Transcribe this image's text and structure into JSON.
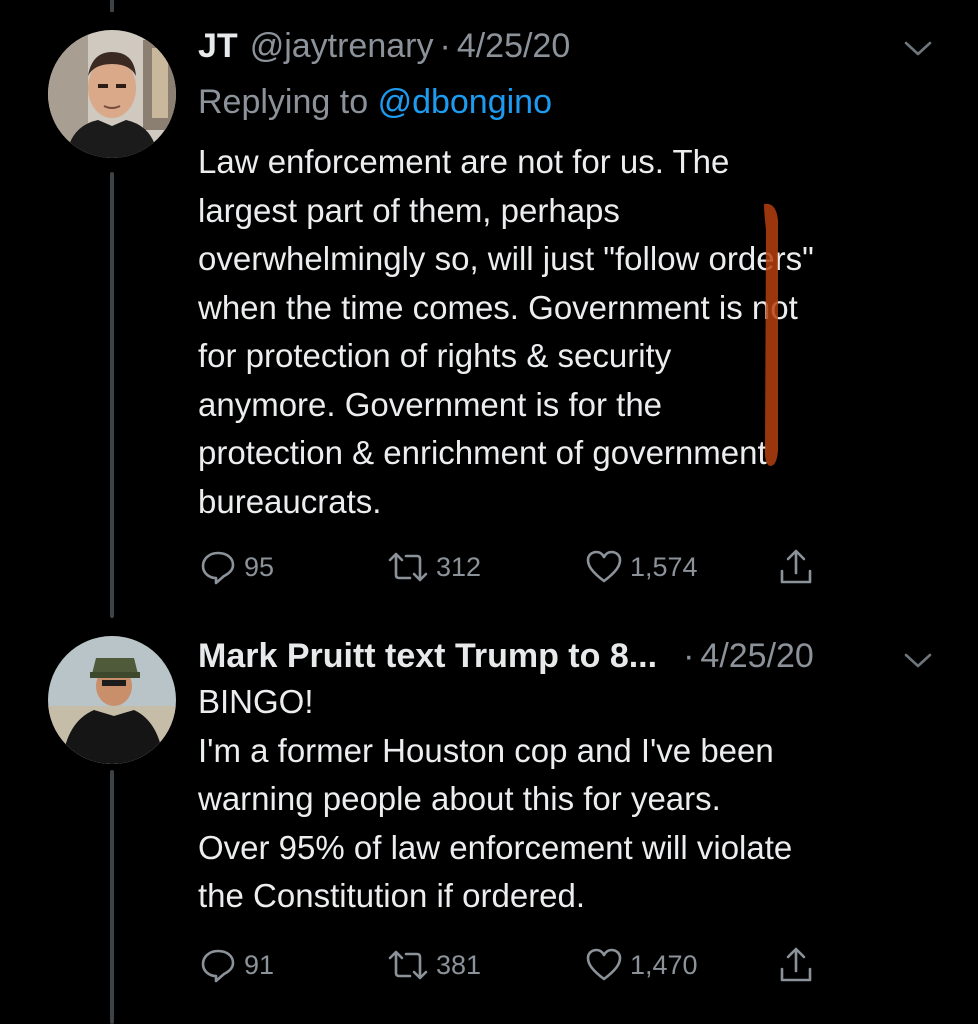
{
  "tweets": [
    {
      "author_name": "JT",
      "handle": "@jaytrenary",
      "separator": "·",
      "date": "4/25/20",
      "replying_prefix": "Replying to",
      "replying_to": "@dbongino",
      "text": "Law enforcement are not for us.  The\nlargest part of them, perhaps\noverwhelmingly so, will just \"follow orders\"\nwhen the time comes.  Government is not\nfor protection of rights & security\nanymore.  Government is for the\nprotection & enrichment of government\nbureaucrats.",
      "replies": "95",
      "retweets": "312",
      "likes": "1,574",
      "icons": [
        "reply-icon",
        "retweet-icon",
        "like-icon",
        "share-icon",
        "chevron-down-icon"
      ]
    },
    {
      "author_name": "Mark Pruitt text Trump to 8...",
      "separator": "·",
      "date": "4/25/20",
      "text": "BINGO!\nI'm a former Houston cop and I've been\nwarning people about this for years.\nOver 95% of law enforcement will violate\nthe Constitution if ordered.",
      "replies": "91",
      "retweets": "381",
      "likes": "1,470",
      "icons": [
        "reply-icon",
        "retweet-icon",
        "like-icon",
        "share-icon",
        "chevron-down-icon"
      ]
    }
  ],
  "colors": {
    "background": "#000000",
    "text": "#ecedef",
    "secondary": "#8b9299",
    "link": "#1d9bf0",
    "thread_line": "#3d4247",
    "annotation_mark": "#b5400f"
  }
}
